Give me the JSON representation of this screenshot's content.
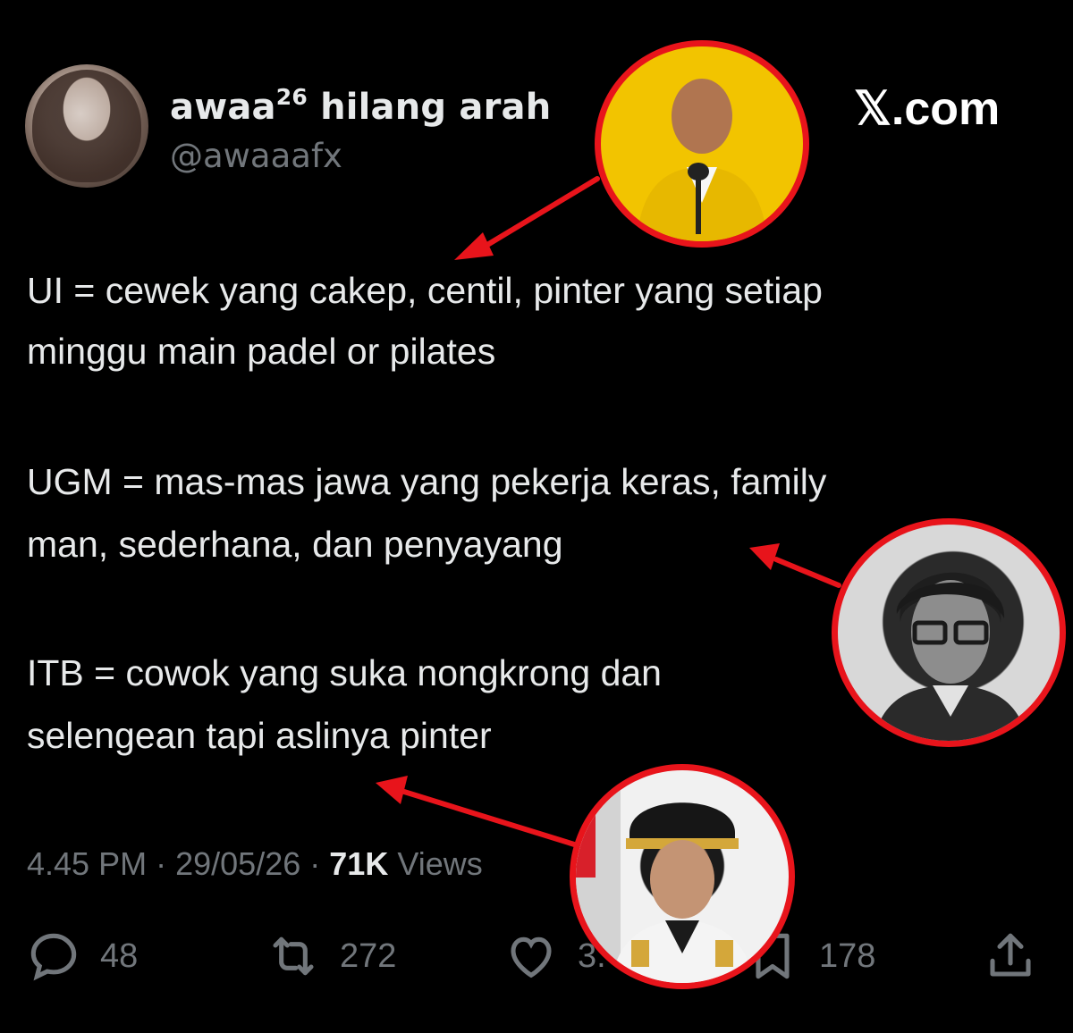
{
  "author": {
    "name": "awaa",
    "name_superscript": "26",
    "name_suffix": " hilang arah",
    "handle": "@awaaafx",
    "avatar_icon": "profile-photo"
  },
  "brand": "𝕏.com",
  "tweet": {
    "lines": [
      "UI = cewek yang cakep, centil, pinter yang setiap",
      "minggu main padel or pilates",
      "UGM = mas-mas jawa yang pekerja keras, family",
      "man, sederhana, dan penyayang",
      "ITB = cowok yang suka nongkrong dan",
      "selengean tapi aslinya pinter"
    ]
  },
  "meta": {
    "time": "4.45 PM",
    "separator": "·",
    "date": "29/05/26",
    "views_count": "71K",
    "views_label": "Views"
  },
  "actions": {
    "reply_count": "48",
    "repost_count": "272",
    "like_count": "3.",
    "bookmark_count": "178"
  },
  "colors": {
    "background": "#000000",
    "text_primary": "#e7e9ea",
    "text_secondary": "#71767b",
    "annotation_red": "#e8141b"
  }
}
